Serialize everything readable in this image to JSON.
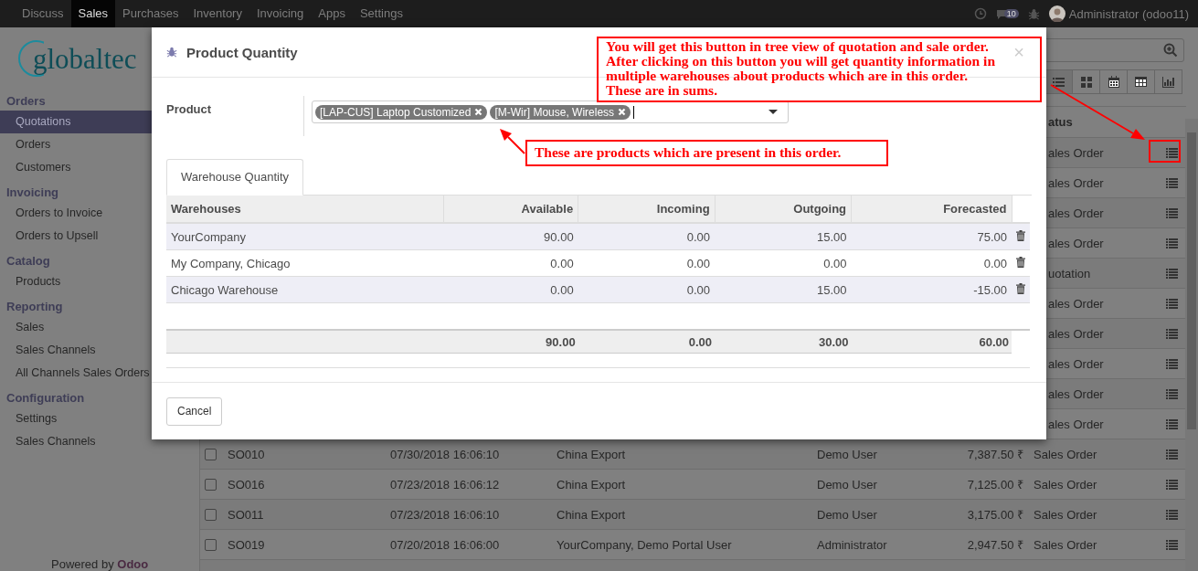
{
  "navbar": {
    "apps": [
      {
        "label": "Discuss",
        "selected": false
      },
      {
        "label": "Sales",
        "selected": true
      },
      {
        "label": "Purchases",
        "selected": false
      },
      {
        "label": "Inventory",
        "selected": false
      },
      {
        "label": "Invoicing",
        "selected": false
      },
      {
        "label": "Apps",
        "selected": false
      },
      {
        "label": "Settings",
        "selected": false
      }
    ],
    "message_count": "10",
    "user": "Administrator (odoo11)"
  },
  "sidebar": {
    "logo": "globaltec",
    "sections": [
      {
        "title": "Orders",
        "items": [
          {
            "label": "Quotations",
            "selected": true
          },
          {
            "label": "Orders",
            "selected": false
          },
          {
            "label": "Customers",
            "selected": false
          }
        ]
      },
      {
        "title": "Invoicing",
        "items": [
          {
            "label": "Orders to Invoice",
            "selected": false
          },
          {
            "label": "Orders to Upsell",
            "selected": false
          }
        ]
      },
      {
        "title": "Catalog",
        "items": [
          {
            "label": "Products",
            "selected": false
          }
        ]
      },
      {
        "title": "Reporting",
        "items": [
          {
            "label": "Sales",
            "selected": false
          },
          {
            "label": "Sales Channels",
            "selected": false
          },
          {
            "label": "All Channels Sales Orders",
            "selected": false
          }
        ]
      },
      {
        "title": "Configuration",
        "items": [
          {
            "label": "Settings",
            "selected": false
          },
          {
            "label": "Sales Channels",
            "selected": false
          }
        ]
      }
    ],
    "footer": {
      "prefix": "Powered by",
      "brand": "Odoo"
    }
  },
  "control_panel": {
    "views": [
      {
        "kind": "list",
        "selected": true
      },
      {
        "kind": "kanban",
        "selected": false
      },
      {
        "kind": "calendar",
        "selected": false
      },
      {
        "kind": "pivot",
        "selected": false
      },
      {
        "kind": "graph",
        "selected": false
      }
    ]
  },
  "list": {
    "status_heading": "atus",
    "rows": [
      {
        "kind": "covered",
        "status": "ales Order"
      },
      {
        "kind": "covered",
        "status": "ales Order"
      },
      {
        "kind": "covered",
        "status": "ales Order"
      },
      {
        "kind": "covered",
        "status": "ales Order"
      },
      {
        "kind": "covered",
        "status": "uotation"
      },
      {
        "kind": "covered",
        "status": "ales Order"
      },
      {
        "kind": "covered",
        "status": "ales Order"
      },
      {
        "kind": "covered",
        "status": "ales Order"
      },
      {
        "kind": "covered",
        "status": "ales Order"
      },
      {
        "kind": "covered",
        "status": "ales Order"
      },
      {
        "kind": "full",
        "checked": false,
        "number": "SO010",
        "date": "07/30/2018 16:06:10",
        "customer": "China Export",
        "salesperson": "Demo User",
        "total": "7,387.50 ₹",
        "status": "Sales Order"
      },
      {
        "kind": "full",
        "checked": false,
        "number": "SO016",
        "date": "07/23/2018 16:06:12",
        "customer": "China Export",
        "salesperson": "Demo User",
        "total": "7,125.00 ₹",
        "status": "Sales Order"
      },
      {
        "kind": "full",
        "checked": false,
        "number": "SO011",
        "date": "07/23/2018 16:06:10",
        "customer": "China Export",
        "salesperson": "Demo User",
        "total": "3,175.00 ₹",
        "status": "Sales Order"
      },
      {
        "kind": "full",
        "checked": false,
        "number": "SO019",
        "date": "07/20/2018 16:06:00",
        "customer": "YourCompany, Demo Portal User",
        "salesperson": "Administrator",
        "total": "2,947.50 ₹",
        "status": "Sales Order"
      }
    ]
  },
  "dialog": {
    "title": "Product Quantity",
    "close": "×",
    "product_label": "Product",
    "tags": [
      {
        "label": "[LAP-CUS] Laptop Customized"
      },
      {
        "label": "[M-Wir] Mouse, Wireless"
      }
    ],
    "tabs": [
      {
        "label": "Warehouse Quantity",
        "selected": true
      }
    ],
    "columns": [
      "Warehouses",
      "Available",
      "Incoming",
      "Outgoing",
      "Forecasted"
    ],
    "rows": [
      [
        "YourCompany",
        "90.00",
        "0.00",
        "15.00",
        "75.00"
      ],
      [
        "My Company, Chicago",
        "0.00",
        "0.00",
        "0.00",
        "0.00"
      ],
      [
        "Chicago Warehouse",
        "0.00",
        "0.00",
        "15.00",
        "-15.00"
      ]
    ],
    "totals": [
      "90.00",
      "0.00",
      "30.00",
      "60.00"
    ],
    "cancel": "Cancel"
  },
  "annotations": [
    {
      "lines": [
        "You will get this button in tree view of quotation and sale order.",
        "After clicking on this button you will get quantity information in",
        "multiple warehouses about products which are in this order.",
        "These are in sums."
      ]
    },
    {
      "lines": [
        "These are products which are present in this order."
      ]
    }
  ]
}
